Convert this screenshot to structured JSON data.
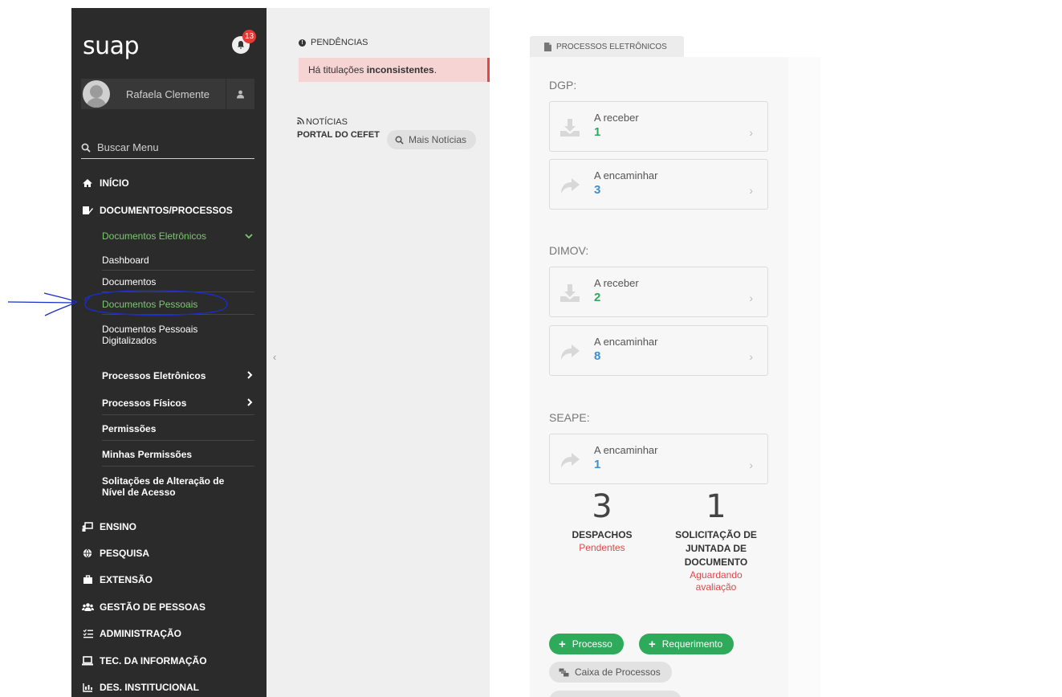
{
  "sidebar": {
    "logo": "suap",
    "notification_count": "13",
    "username": "Rafaela Clemente",
    "search_placeholder": "Buscar Menu",
    "menu": {
      "inicio": "INÍCIO",
      "documentos_processos": "DOCUMENTOS/PROCESSOS",
      "documentos_eletronicos": "Documentos Eletrônicos",
      "dashboard": "Dashboard",
      "documentos": "Documentos",
      "documentos_pessoais": "Documentos Pessoais",
      "documentos_pessoais_digitalizados": "Documentos Pessoais Digitalizados",
      "processos_eletronicos": "Processos Eletrônicos",
      "processos_fisicos": "Processos Físicos",
      "permissoes": "Permissões",
      "minhas_permissoes": "Minhas Permissões",
      "solicitacoes": "Solitações de Alteração de Nível de Acesso",
      "ensino": "ENSINO",
      "pesquisa": "PESQUISA",
      "extensao": "EXTENSÃO",
      "gestao_pessoas": "GESTÃO DE PESSOAS",
      "administracao": "ADMINISTRAÇÃO",
      "tec_informacao": "TEC. DA INFORMAÇÃO",
      "des_institucional": "DES. INSTITUCIONAL"
    }
  },
  "middle": {
    "pendencias_title": "PENDÊNCIAS",
    "alert_prefix": "Há titulações ",
    "alert_bold": "inconsistentes",
    "alert_suffix": ".",
    "noticias_title": "NOTÍCIAS",
    "noticias_source": "PORTAL DO CEFET",
    "mais_noticias": "Mais Notícias"
  },
  "right": {
    "tab": "PROCESSOS ELETRÔNICOS",
    "sections": [
      {
        "label": "DGP:",
        "cards": [
          {
            "label": "A receber",
            "count": "1"
          },
          {
            "label": "A encaminhar",
            "count": "3"
          }
        ]
      },
      {
        "label": "DIMOV:",
        "cards": [
          {
            "label": "A receber",
            "count": "2"
          },
          {
            "label": "A encaminhar",
            "count": "8"
          }
        ]
      },
      {
        "label": "SEAPE:",
        "cards": [
          {
            "label": "A encaminhar",
            "count": "1"
          }
        ]
      }
    ],
    "stats": [
      {
        "num": "3",
        "label": "DESPACHOS",
        "status": "Pendentes"
      },
      {
        "num": "1",
        "label": "SOLICITAÇÃO DE JUNTADA DE DOCUMENTO",
        "status": "Aguardando avaliação"
      }
    ],
    "buttons": {
      "processo": "Processo",
      "requerimento": "Requerimento",
      "caixa": "Caixa de Processos"
    }
  },
  "colors": {
    "sidebar_bg": "#2b2b2b",
    "green_accent": "#7bc96f",
    "count_green": "#2eaa5b",
    "count_blue": "#3b8fd6",
    "alert_red": "#e04848"
  }
}
